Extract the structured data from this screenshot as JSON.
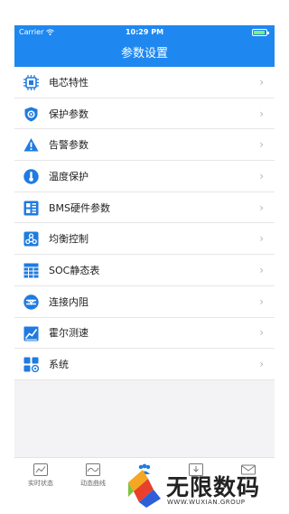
{
  "status_bar": {
    "carrier": "Carrier",
    "time": "10:29 PM"
  },
  "header": {
    "title": "参数设置"
  },
  "menu": {
    "items": [
      {
        "label": "电芯特性",
        "icon": "cell-chip-icon"
      },
      {
        "label": "保护参数",
        "icon": "shield-gear-icon"
      },
      {
        "label": "告警参数",
        "icon": "warning-icon"
      },
      {
        "label": "温度保护",
        "icon": "thermometer-icon"
      },
      {
        "label": "BMS硬件参数",
        "icon": "hardware-board-icon"
      },
      {
        "label": "均衡控制",
        "icon": "balance-nodes-icon"
      },
      {
        "label": "SOC静态表",
        "icon": "table-grid-icon"
      },
      {
        "label": "连接内阻",
        "icon": "resistance-icon"
      },
      {
        "label": "霍尔测速",
        "icon": "hall-speed-icon"
      },
      {
        "label": "系统",
        "icon": "system-grid-icon"
      }
    ],
    "chevron": "›"
  },
  "tabbar": {
    "tabs": [
      {
        "label": "实时状态",
        "icon": "realtime-status-icon"
      },
      {
        "label": "动态曲线",
        "icon": "dynamic-curve-icon"
      }
    ]
  },
  "watermark": {
    "text": "无限数码",
    "subtext": "WWW.WUXIAN.GROUP"
  },
  "colors": {
    "accent": "#1f88f0",
    "background": "#f3f3f5"
  }
}
